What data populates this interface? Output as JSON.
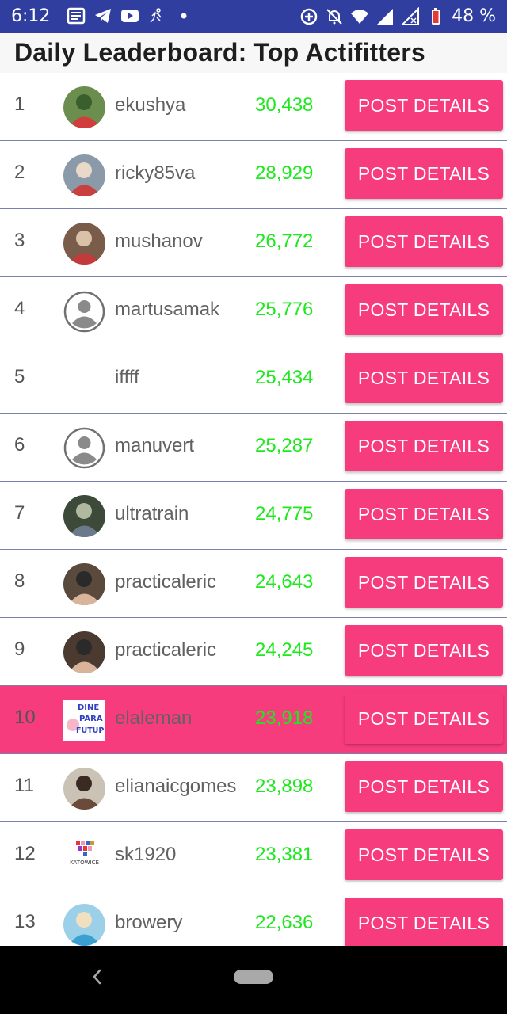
{
  "status_bar": {
    "time": "6:12",
    "battery": "48 %",
    "left_icons": [
      "news-icon",
      "telegram-icon",
      "youtube-icon",
      "fitness-icon",
      "dot-icon"
    ],
    "right_icons": [
      "data-saver-icon",
      "do-not-disturb-icon",
      "wifi-icon",
      "signal-icon",
      "signal-icon",
      "battery-icon"
    ]
  },
  "app": {
    "title": "Daily Leaderboard: Top Actifitters"
  },
  "colors": {
    "accent": "#f63c7c",
    "score": "#1ee81e",
    "status_bar": "#303f9f"
  },
  "leaderboard": [
    {
      "rank": "1",
      "user": "ekushya",
      "score": "30,438",
      "button": "POST DETAILS",
      "avatar": "photo"
    },
    {
      "rank": "2",
      "user": "ricky85va",
      "score": "28,929",
      "button": "POST DETAILS",
      "avatar": "photo"
    },
    {
      "rank": "3",
      "user": "mushanov",
      "score": "26,772",
      "button": "POST DETAILS",
      "avatar": "photo"
    },
    {
      "rank": "4",
      "user": "martusamak",
      "score": "25,776",
      "button": "POST DETAILS",
      "avatar": "default-user-icon"
    },
    {
      "rank": "5",
      "user": "iffff",
      "score": "25,434",
      "button": "POST DETAILS",
      "avatar": "none"
    },
    {
      "rank": "6",
      "user": "manuvert",
      "score": "25,287",
      "button": "POST DETAILS",
      "avatar": "default-user-icon"
    },
    {
      "rank": "7",
      "user": "ultratrain",
      "score": "24,775",
      "button": "POST DETAILS",
      "avatar": "photo"
    },
    {
      "rank": "8",
      "user": "practicaleric",
      "score": "24,643",
      "button": "POST DETAILS",
      "avatar": "photo"
    },
    {
      "rank": "9",
      "user": "practicaleric",
      "score": "24,245",
      "button": "POST DETAILS",
      "avatar": "photo"
    },
    {
      "rank": "10",
      "user": "elaleman",
      "score": "23,918",
      "button": "POST DETAILS",
      "avatar": "sign",
      "avatar_text": [
        "DINE",
        "PARA",
        "FUTUP"
      ],
      "highlighted": true
    },
    {
      "rank": "11",
      "user": "elianaicgomes",
      "score": "23,898",
      "button": "POST DETAILS",
      "avatar": "photo"
    },
    {
      "rank": "12",
      "user": "sk1920",
      "score": "23,381",
      "button": "POST DETAILS",
      "avatar": "logo",
      "avatar_text": [
        "KATOWICE"
      ]
    },
    {
      "rank": "13",
      "user": "browery",
      "score": "22,636",
      "button": "POST DETAILS",
      "avatar": "photo"
    }
  ],
  "nav_bar": {
    "back_icon": "back-chevron-icon",
    "home_icon": "home-pill-icon"
  }
}
